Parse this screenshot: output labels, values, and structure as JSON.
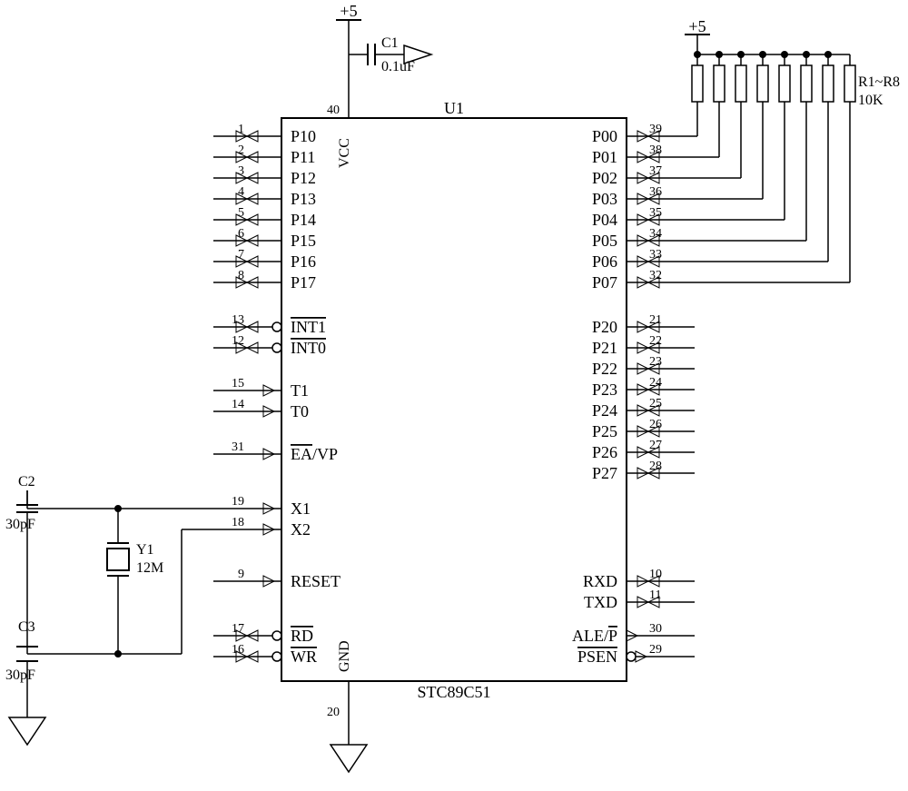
{
  "chip": {
    "designator": "U1",
    "partNumber": "STC89C51"
  },
  "leftPins": [
    {
      "num": "1",
      "name": "P10"
    },
    {
      "num": "2",
      "name": "P11"
    },
    {
      "num": "3",
      "name": "P12"
    },
    {
      "num": "4",
      "name": "P13"
    },
    {
      "num": "5",
      "name": "P14"
    },
    {
      "num": "6",
      "name": "P15"
    },
    {
      "num": "7",
      "name": "P16"
    },
    {
      "num": "8",
      "name": "P17"
    },
    {
      "num": "13",
      "name": "INT1"
    },
    {
      "num": "12",
      "name": "INT0"
    },
    {
      "num": "15",
      "name": "T1"
    },
    {
      "num": "14",
      "name": "T0"
    },
    {
      "num": "31",
      "name": "EA/VP"
    },
    {
      "num": "19",
      "name": "X1"
    },
    {
      "num": "18",
      "name": "X2"
    },
    {
      "num": "9",
      "name": "RESET"
    },
    {
      "num": "17",
      "name": "RD"
    },
    {
      "num": "16",
      "name": "WR"
    }
  ],
  "rightPins": [
    {
      "num": "39",
      "name": "P00"
    },
    {
      "num": "38",
      "name": "P01"
    },
    {
      "num": "37",
      "name": "P02"
    },
    {
      "num": "36",
      "name": "P03"
    },
    {
      "num": "35",
      "name": "P04"
    },
    {
      "num": "34",
      "name": "P05"
    },
    {
      "num": "33",
      "name": "P06"
    },
    {
      "num": "32",
      "name": "P07"
    },
    {
      "num": "21",
      "name": "P20"
    },
    {
      "num": "22",
      "name": "P21"
    },
    {
      "num": "23",
      "name": "P22"
    },
    {
      "num": "24",
      "name": "P23"
    },
    {
      "num": "25",
      "name": "P24"
    },
    {
      "num": "26",
      "name": "P25"
    },
    {
      "num": "27",
      "name": "P26"
    },
    {
      "num": "28",
      "name": "P27"
    },
    {
      "num": "10",
      "name": "RXD"
    },
    {
      "num": "11",
      "name": "TXD"
    },
    {
      "num": "30",
      "name": "ALE/P"
    },
    {
      "num": "29",
      "name": "PSEN"
    }
  ],
  "topPin": {
    "num": "40",
    "name": "VCC"
  },
  "bottomPin": {
    "num": "20",
    "name": "GND"
  },
  "power": {
    "top": "+5",
    "pullup": "+5"
  },
  "components": {
    "c1": {
      "name": "C1",
      "value": "0.1uF"
    },
    "c2": {
      "name": "C2",
      "value": "30pF"
    },
    "c3": {
      "name": "C3",
      "value": "30pF"
    },
    "y1": {
      "name": "Y1",
      "value": "12M"
    },
    "resistors": {
      "name": "R1~R8",
      "value": "10K"
    }
  }
}
